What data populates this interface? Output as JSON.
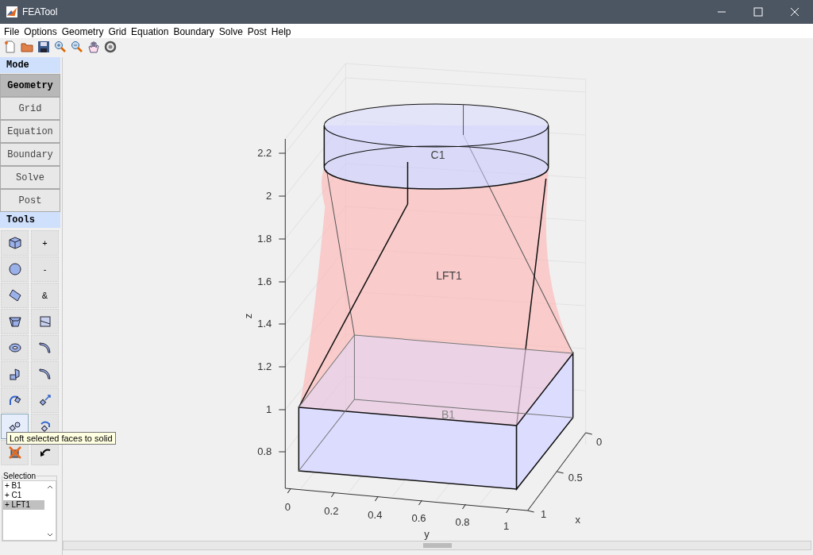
{
  "window": {
    "title": "FEATool"
  },
  "menu": [
    "File",
    "Options",
    "Geometry",
    "Grid",
    "Equation",
    "Boundary",
    "Solve",
    "Post",
    "Help"
  ],
  "mode": {
    "header": "Mode",
    "items": [
      {
        "label": "Geometry",
        "selected": true
      },
      {
        "label": "Grid",
        "selected": false
      },
      {
        "label": "Equation",
        "selected": false
      },
      {
        "label": "Boundary",
        "selected": false
      },
      {
        "label": "Solve",
        "selected": false
      },
      {
        "label": "Post",
        "selected": false
      }
    ]
  },
  "tools": {
    "header": "Tools",
    "items": [
      {
        "kind": "icon",
        "highlighted": false
      },
      {
        "kind": "text",
        "label": "+",
        "highlighted": false
      },
      {
        "kind": "icon",
        "highlighted": false
      },
      {
        "kind": "text",
        "label": "-",
        "highlighted": false
      },
      {
        "kind": "icon",
        "highlighted": false
      },
      {
        "kind": "text",
        "label": "&",
        "highlighted": false
      },
      {
        "kind": "icon",
        "highlighted": false
      },
      {
        "kind": "icon",
        "highlighted": false
      },
      {
        "kind": "icon",
        "highlighted": false
      },
      {
        "kind": "icon",
        "highlighted": false
      },
      {
        "kind": "icon",
        "highlighted": false
      },
      {
        "kind": "icon",
        "highlighted": false
      },
      {
        "kind": "icon",
        "highlighted": false
      },
      {
        "kind": "icon",
        "highlighted": false
      },
      {
        "kind": "icon",
        "highlighted": true
      },
      {
        "kind": "icon",
        "highlighted": false
      },
      {
        "kind": "icon",
        "highlighted": false
      },
      {
        "kind": "icon",
        "highlighted": false
      }
    ]
  },
  "tooltip": "Loft selected faces to solid",
  "selection": {
    "label": "Selection",
    "items": [
      {
        "label": "+ B1",
        "selected": false
      },
      {
        "label": "+ C1",
        "selected": false
      },
      {
        "label": "+ LFT1",
        "selected": true
      }
    ]
  },
  "plot": {
    "objects": [
      "C1",
      "LFT1",
      "B1"
    ],
    "z_label": "z",
    "y_label": "y",
    "x_label": "x",
    "z_ticks": [
      "2.2",
      "2",
      "1.8",
      "1.6",
      "1.4",
      "1.2",
      "1",
      "0.8"
    ],
    "y_ticks": [
      "0",
      "0.2",
      "0.4",
      "0.6",
      "0.8",
      "1"
    ],
    "x_ticks": [
      "0",
      "0.5",
      "1"
    ]
  }
}
